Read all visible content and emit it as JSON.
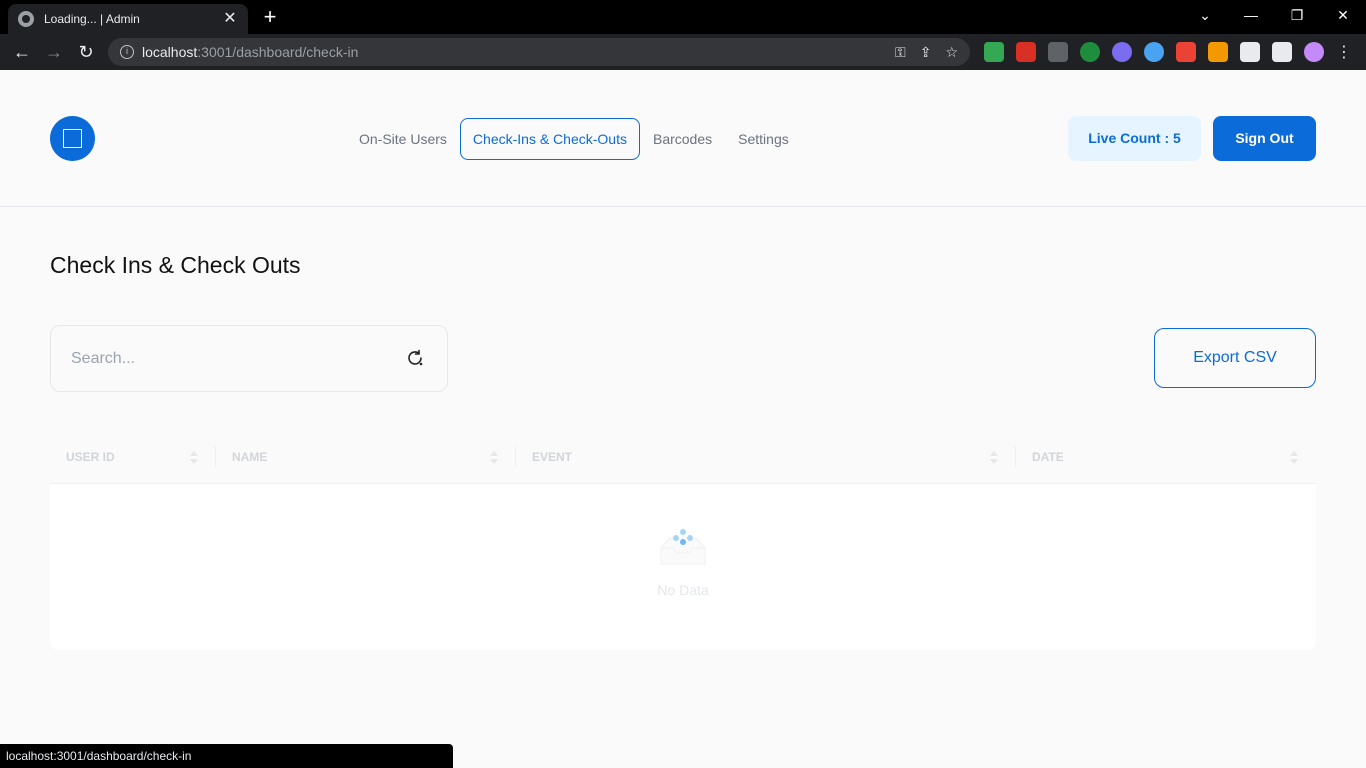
{
  "browser": {
    "tab_title": "Loading... | Admin",
    "tab_close": "✕",
    "new_tab": "+",
    "url_host": "localhost",
    "url_rest": ":3001/dashboard/check-in",
    "status_url": "localhost:3001/dashboard/check-in",
    "window_controls": [
      "⌄",
      "—",
      "❐",
      "✕"
    ],
    "extension_colors": [
      "#34a853",
      "#d93025",
      "#5f6368",
      "#1e8e3e",
      "#7c6cf0",
      "#4aa3f0",
      "#ea4335",
      "#f29900",
      "#e8eaed",
      "#e8eaed",
      "#c58af9"
    ]
  },
  "header": {
    "nav": [
      {
        "label": "On-Site Users",
        "active": false
      },
      {
        "label": "Check-Ins & Check-Outs",
        "active": true
      },
      {
        "label": "Barcodes",
        "active": false
      },
      {
        "label": "Settings",
        "active": false
      }
    ],
    "live_count_label": "Live Count : 5",
    "sign_out_label": "Sign Out"
  },
  "main": {
    "title": "Check Ins & Check Outs",
    "search_placeholder": "Search...",
    "export_label": "Export CSV",
    "table": {
      "columns": [
        "USER ID",
        "NAME",
        "EVENT",
        "DATE"
      ],
      "empty_text": "No Data"
    }
  },
  "colors": {
    "primary": "#0b6bd8",
    "live_count_bg": "#e6f4ff"
  }
}
